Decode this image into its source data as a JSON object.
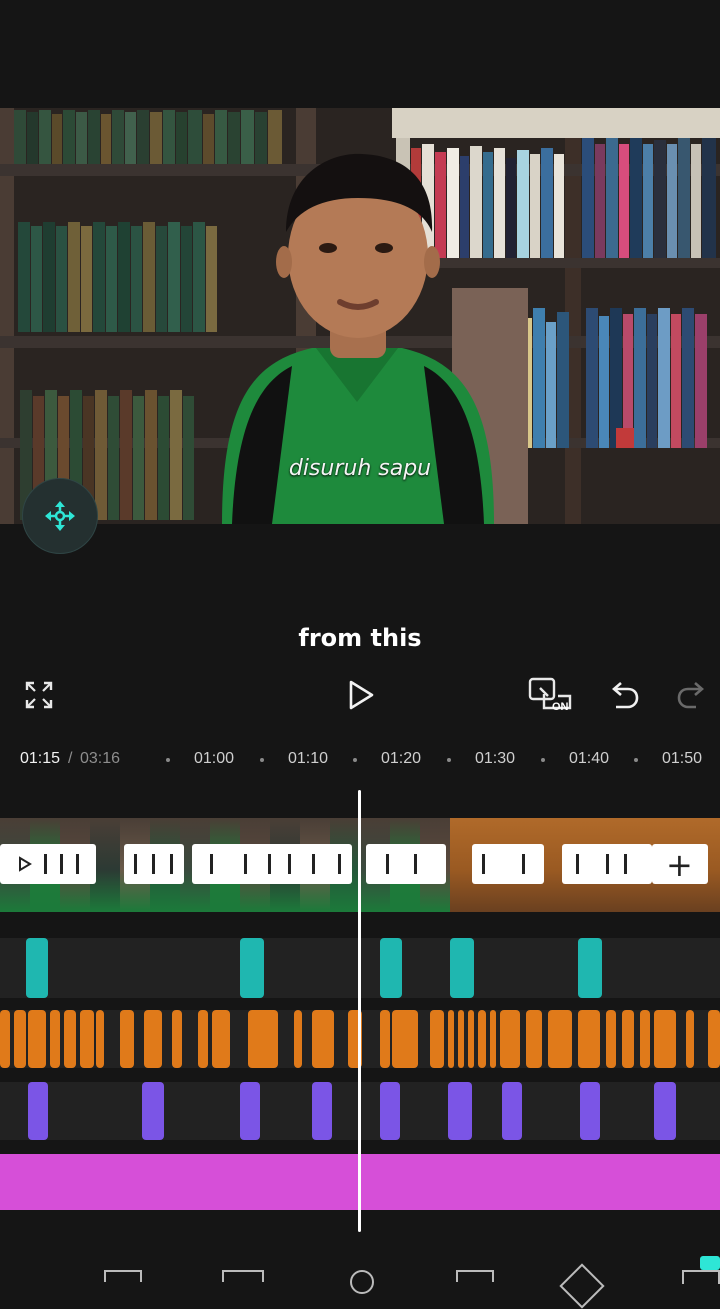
{
  "preview": {
    "overlay_caption": "disuruh sapu"
  },
  "subtitle_text": "from this",
  "toolbar": {
    "fullscreen_icon": "expand-icon",
    "play_icon": "play-icon",
    "keyframe_toggle_label": "ON",
    "undo_icon": "undo-icon",
    "redo_icon": "redo-icon"
  },
  "timeline": {
    "current_time": "01:15",
    "separator": "/",
    "total_duration": "03:16",
    "ruler_ticks": [
      "01:00",
      "01:10",
      "01:20",
      "01:30",
      "01:40",
      "01:50"
    ],
    "add_clip_label": "+"
  },
  "colors": {
    "background": "#151515",
    "effect_clip": "#1fb7b0",
    "text_clip": "#e07a1a",
    "sticker_clip": "#7b55e6",
    "audio_clip": "#d64fd8",
    "accent": "#2ee6d6"
  }
}
